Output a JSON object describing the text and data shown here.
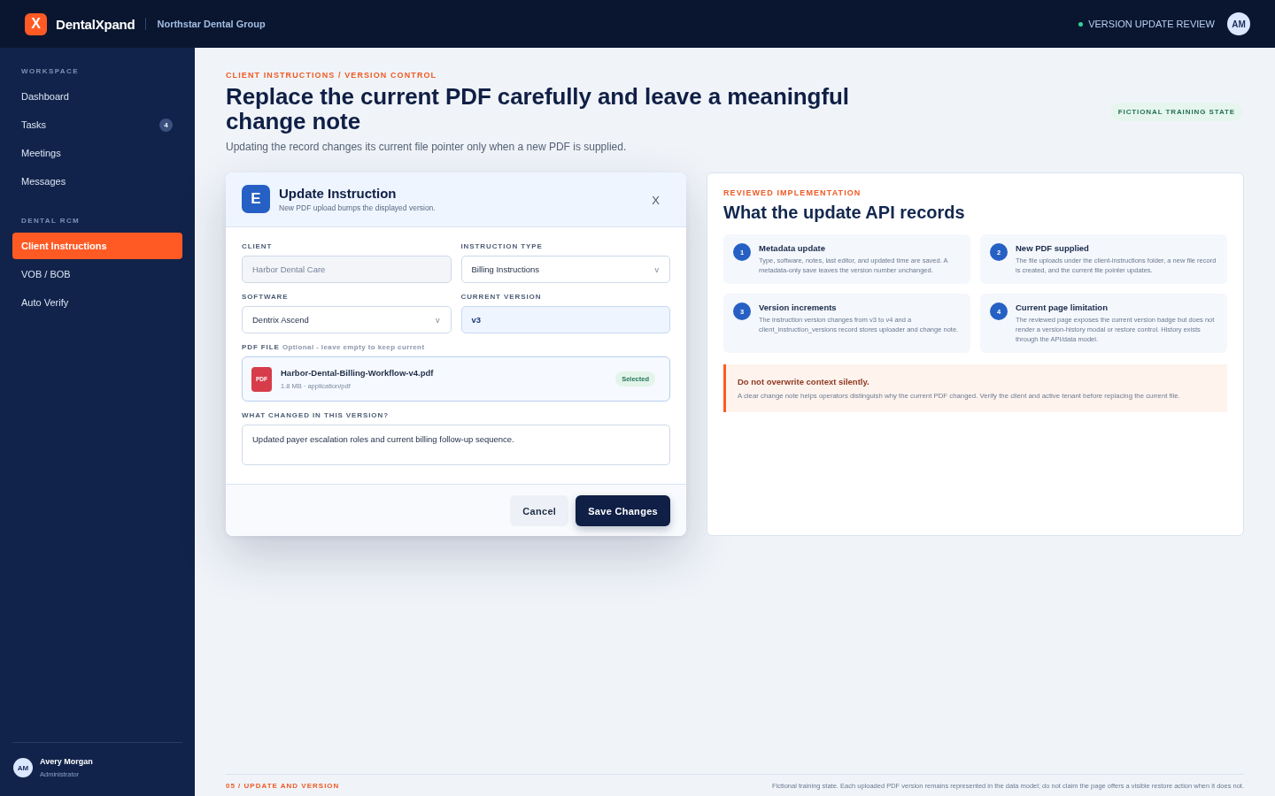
{
  "topbar": {
    "logo_letter": "X",
    "brand": "DentalXpand",
    "org": "Northstar Dental Group",
    "status": "VERSION UPDATE REVIEW",
    "avatar": "AM"
  },
  "sidebar": {
    "sections": [
      {
        "label": "WORKSPACE",
        "items": [
          {
            "label": "Dashboard",
            "selected": false
          },
          {
            "label": "Tasks",
            "badge": "4",
            "selected": false
          },
          {
            "label": "Meetings",
            "selected": false
          },
          {
            "label": "Messages",
            "selected": false
          }
        ]
      },
      {
        "label": "DENTAL RCM",
        "items": [
          {
            "label": "Client Instructions",
            "selected": true
          },
          {
            "label": "VOB / BOB",
            "selected": false
          },
          {
            "label": "Auto Verify",
            "selected": false
          }
        ]
      }
    ],
    "user": {
      "avatar": "AM",
      "name": "Avery Morgan",
      "role": "Administrator"
    }
  },
  "header": {
    "eyebrow": "CLIENT INSTRUCTIONS / VERSION CONTROL",
    "title": "Replace the current PDF carefully and leave a meaningful change note",
    "subtitle": "Updating the record changes its current file pointer only when a new PDF is supplied.",
    "badge": "FICTIONAL TRAINING STATE"
  },
  "modal": {
    "icon_letter": "E",
    "title": "Update Instruction",
    "subtitle": "New PDF upload bumps the displayed version.",
    "close": "X",
    "fields": [
      {
        "label": "CLIENT",
        "kind": "locked",
        "value": "Harbor Dental Care"
      },
      {
        "label": "INSTRUCTION TYPE",
        "kind": "select",
        "value": "Billing Instructions",
        "caret": "v"
      },
      {
        "label": "SOFTWARE",
        "kind": "select",
        "value": "Dentrix Ascend",
        "caret": "v"
      },
      {
        "label": "CURRENT VERSION",
        "kind": "version",
        "value": "v3"
      }
    ],
    "pdf_file": {
      "label": "PDF FILE",
      "hint": "Optional - leave empty to keep current",
      "type_text": "PDF",
      "name": "Harbor-Dental-Billing-Workflow-v4.pdf",
      "meta": "1.8 MB · application/pdf",
      "status": "Selected"
    },
    "change_note": {
      "label": "WHAT CHANGED IN THIS VERSION?",
      "value": "Updated payer escalation roles and current billing follow-up sequence."
    },
    "buttons": [
      {
        "label": "Cancel",
        "kind": "secondary"
      },
      {
        "label": "Save Changes",
        "kind": "primary"
      }
    ]
  },
  "panel": {
    "eyebrow": "REVIEWED IMPLEMENTATION",
    "title": "What the update API records",
    "steps": [
      {
        "number": "1",
        "title": "Metadata update",
        "text": "Type, software, notes, last editor, and updated time are saved. A metadata-only save leaves the version number unchanged."
      },
      {
        "number": "2",
        "title": "New PDF supplied",
        "text": "The file uploads under the client-instructions folder, a new file record is created, and the current file pointer updates."
      },
      {
        "number": "3",
        "title": "Version increments",
        "text": "The instruction version changes from v3 to v4 and a client_instruction_versions record stores uploader and change note."
      },
      {
        "number": "4",
        "title": "Current page limitation",
        "text": "The reviewed page exposes the current version badge but does not render a version-history modal or restore control. History exists through the API/data model."
      }
    ],
    "callout": {
      "title": "Do not overwrite context silently.",
      "text": "A clear change note helps operators distinguish why the current PDF changed. Verify the client and active tenant before replacing the current file."
    }
  },
  "footer": {
    "label": "05 / UPDATE AND VERSION",
    "note": "Fictional training state. Each uploaded PDF version remains represented in the data model; do not claim the page offers a visible restore action when it does not."
  }
}
